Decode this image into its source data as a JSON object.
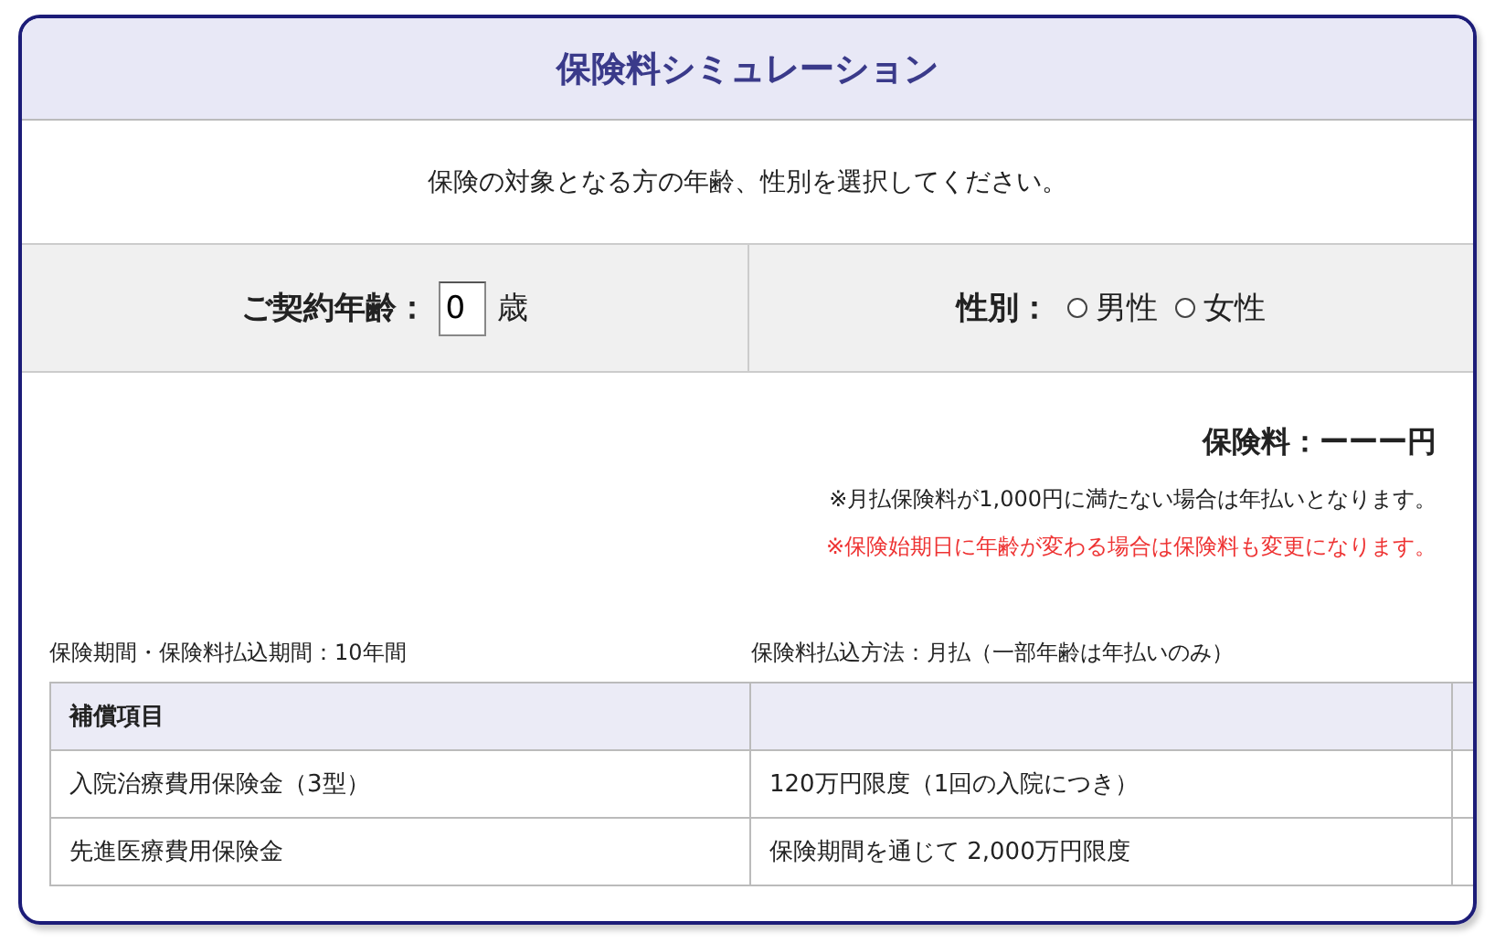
{
  "title": "保険料シミュレーション",
  "instruction": "保険の対象となる方の年齢、性別を選択してください。",
  "age": {
    "label": "ご契約年齢：",
    "value": "0",
    "unit": "歳"
  },
  "gender": {
    "label": "性別：",
    "options": [
      {
        "label": "男性",
        "selected": false
      },
      {
        "label": "女性",
        "selected": false
      }
    ]
  },
  "premium": {
    "label": "保険料：",
    "value": "ーーー円"
  },
  "notes": [
    {
      "text": "※月払保険料が1,000円に満たない場合は年払いとなります。",
      "kind": "normal"
    },
    {
      "text": "※保険始期日に年齢が変わる場合は保険料も変更になります。",
      "kind": "warning"
    }
  ],
  "info": [
    "保険期間・保険料払込期間：10年間",
    "保険料払込方法：月払（一部年齢は年払いのみ）"
  ],
  "table": {
    "header": "補償項目",
    "rows": [
      [
        "入院治療費用保険金（3型）",
        "120万円限度（1回の入院につき）"
      ],
      [
        "先進医療費用保険金",
        "保険期間を通じて 2,000万円限度"
      ]
    ]
  }
}
